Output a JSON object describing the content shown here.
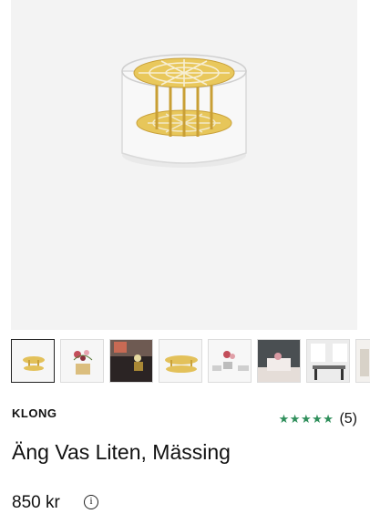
{
  "product": {
    "brand": "KLONG",
    "title": "Äng Vas Liten, Mässing",
    "price": "850 kr",
    "rating_stars": "★★★★★",
    "review_count": "(5)"
  },
  "gallery": {
    "main_image": "brass-flower-grid-vase",
    "thumbnails": [
      "vase-product",
      "vase-with-flowers",
      "vase-on-dark-table",
      "vase-grid-top",
      "three-vases-white",
      "room-interior",
      "dining-room-interior",
      "vase-partial"
    ]
  },
  "colors": {
    "star": "#2f8f5b",
    "brass": "#d9b24a",
    "background": "#f3f3f3"
  }
}
